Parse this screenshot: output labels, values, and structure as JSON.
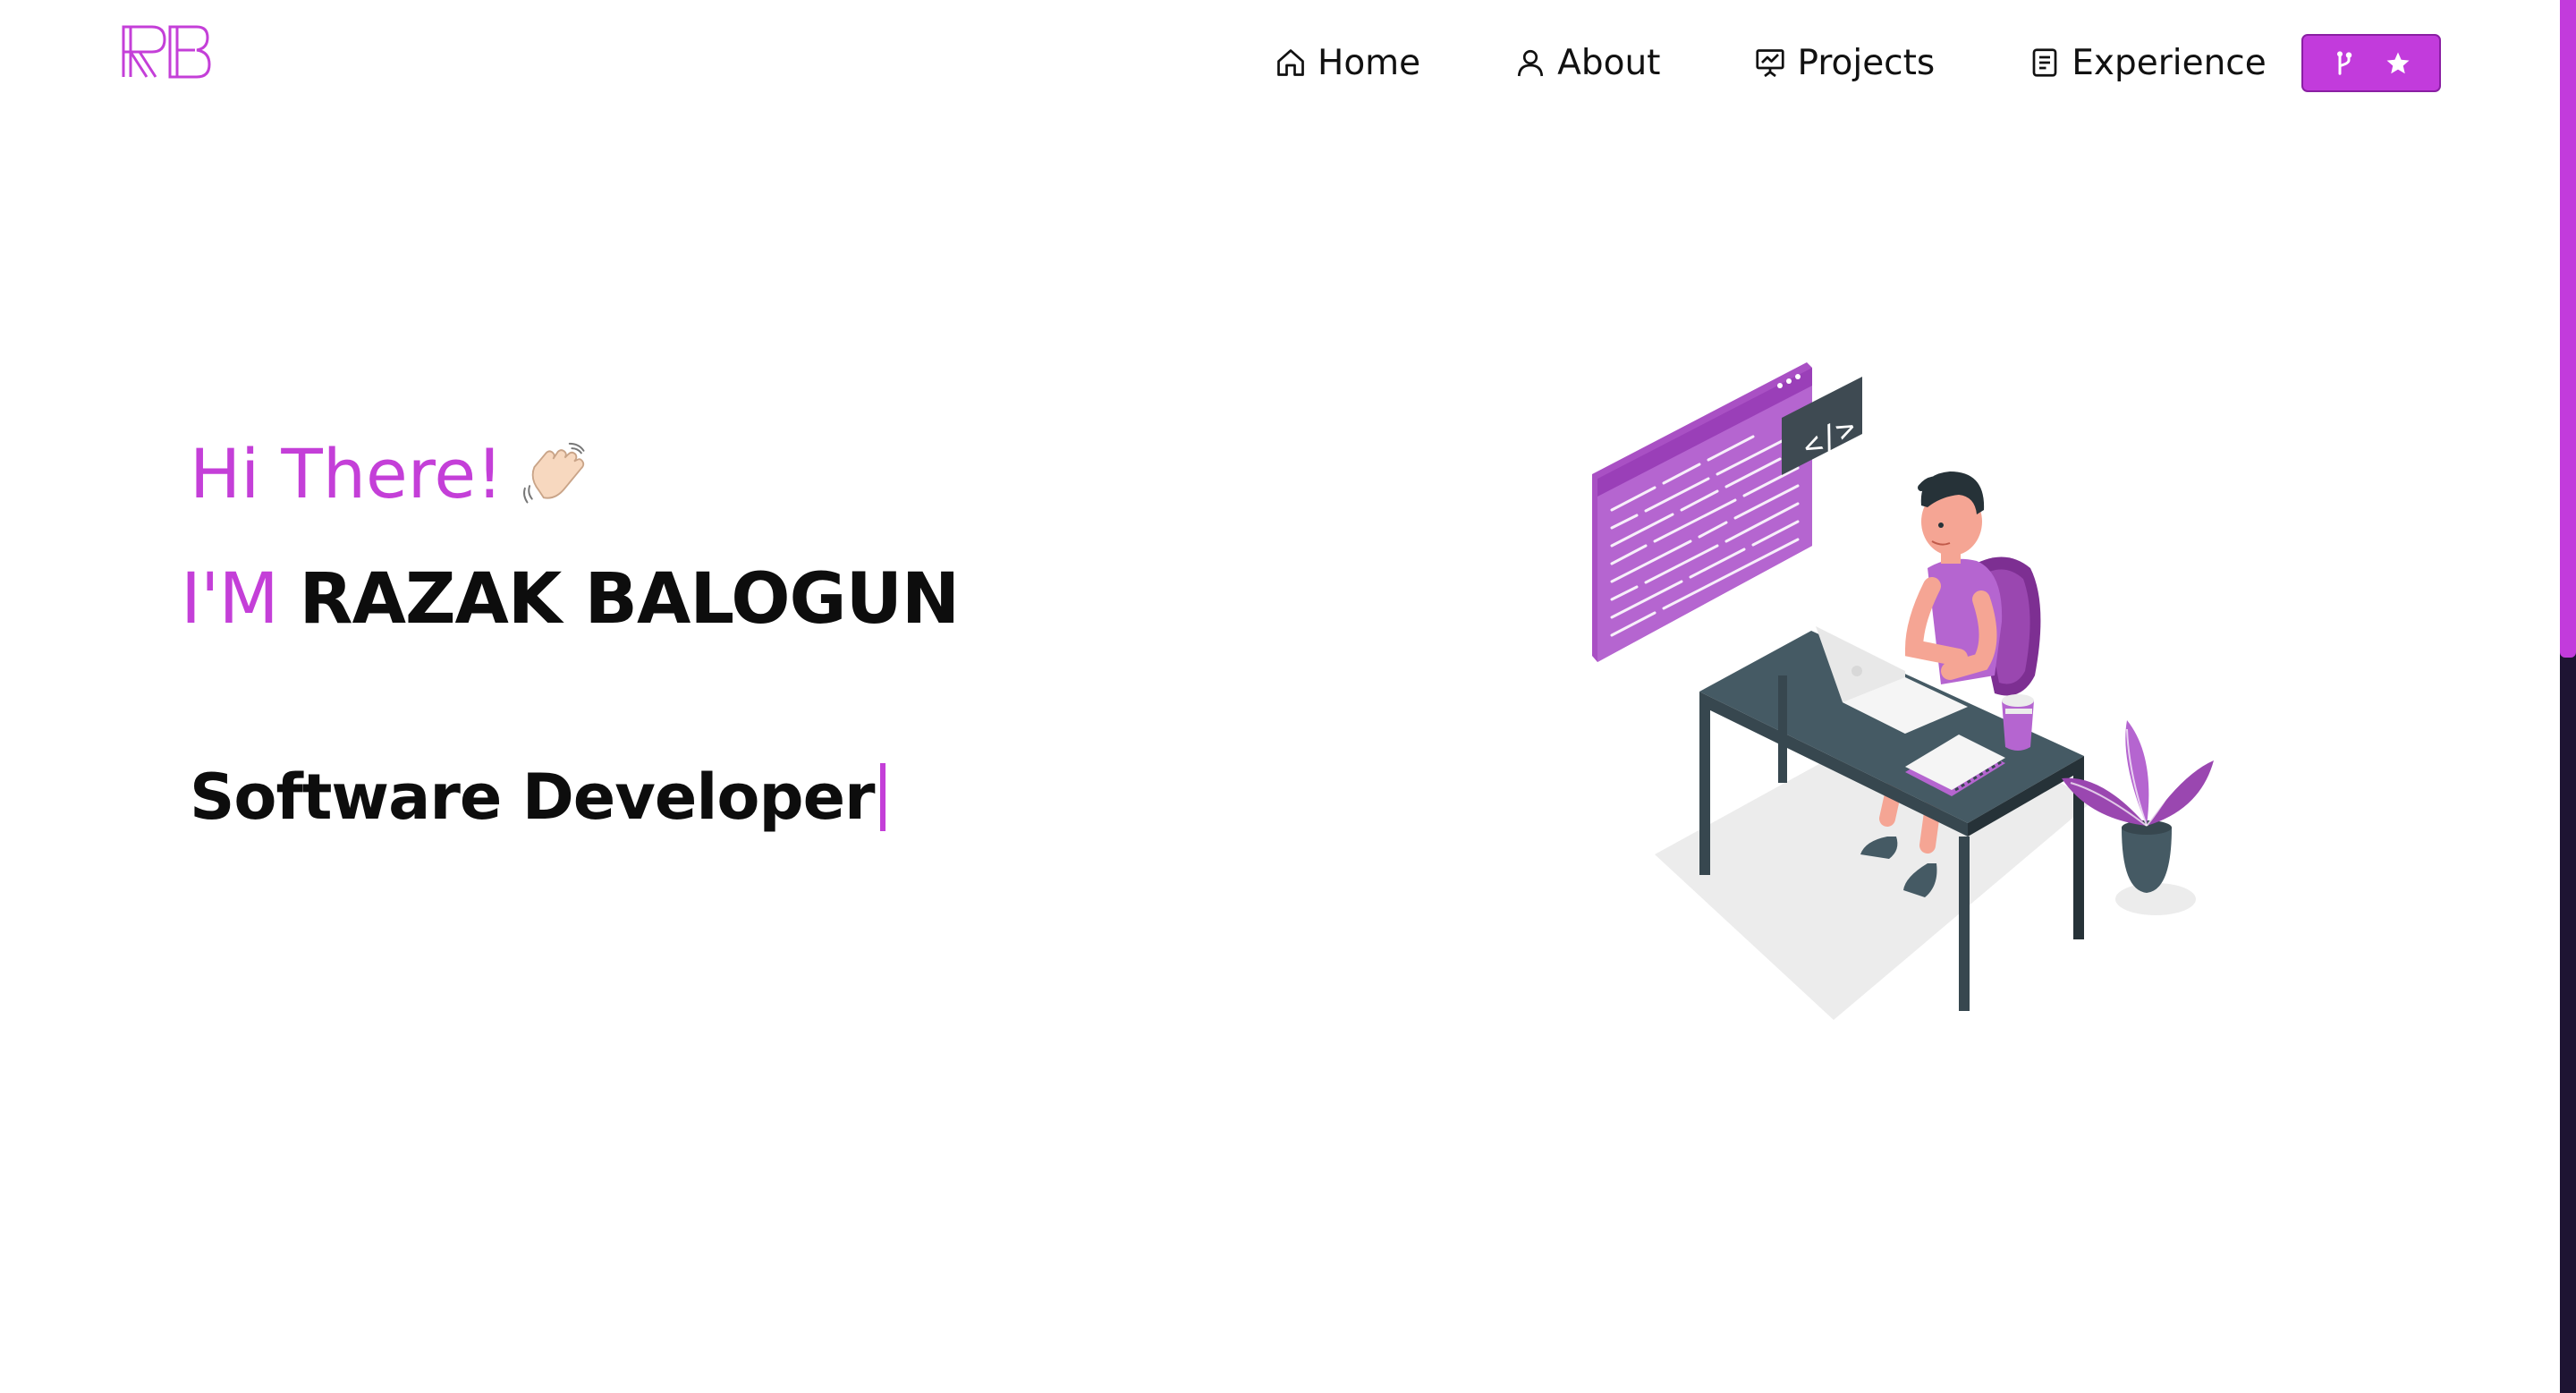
{
  "logo": {
    "text": "RB"
  },
  "nav": {
    "items": [
      {
        "label": "Home",
        "icon": "home-icon"
      },
      {
        "label": "About",
        "icon": "user-icon"
      },
      {
        "label": "Projects",
        "icon": "presentation-icon"
      },
      {
        "label": "Experience",
        "icon": "document-icon"
      }
    ],
    "repo_button": {
      "icons": [
        "git-fork-icon",
        "star-icon"
      ]
    }
  },
  "hero": {
    "greeting": "Hi There!",
    "greeting_emoji": "waving-hand-icon",
    "name_prefix": "I'M",
    "name": "RAZAK BALOGUN",
    "role": "Software Developer"
  },
  "colors": {
    "accent": "#c43fd8",
    "button": "#c23bdc",
    "text": "#0d0d0d",
    "scroll_track": "#1e1433",
    "illustration_purple": "#b25ed1",
    "illustration_dark": "#3e4a52"
  }
}
